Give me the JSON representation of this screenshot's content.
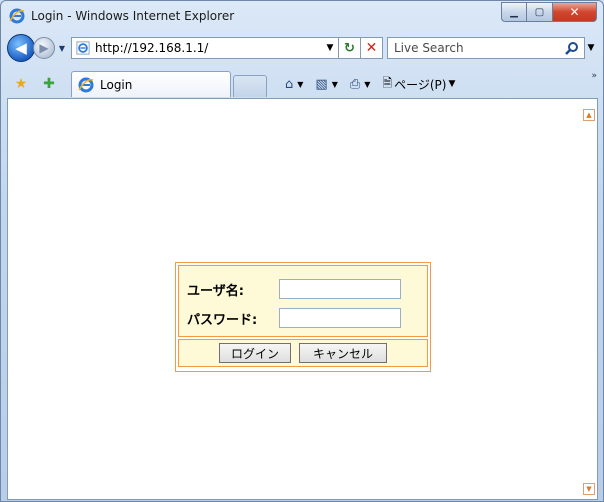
{
  "window": {
    "title": "Login - Windows Internet Explorer",
    "icons": {
      "app": "ie-logo-icon",
      "minimize": "minimize-icon",
      "maximize": "maximize-icon",
      "close": "close-icon"
    }
  },
  "address_bar": {
    "url": "http://192.168.1.1/",
    "search_placeholder": "Live Search"
  },
  "tabs": [
    {
      "label": "Login",
      "icon": "ie-page-icon"
    }
  ],
  "toolbar": {
    "page_menu_label": "ページ(P)",
    "icons": [
      "home-icon",
      "feeds-icon",
      "print-icon",
      "page-icon"
    ]
  },
  "login_form": {
    "username_label": "ユーザ名:",
    "password_label": "パスワード:",
    "username_value": "",
    "password_value": "",
    "login_button": "ログイン",
    "cancel_button": "キャンセル",
    "accent_color": "#f39a43",
    "background_color": "#fef9d7"
  }
}
